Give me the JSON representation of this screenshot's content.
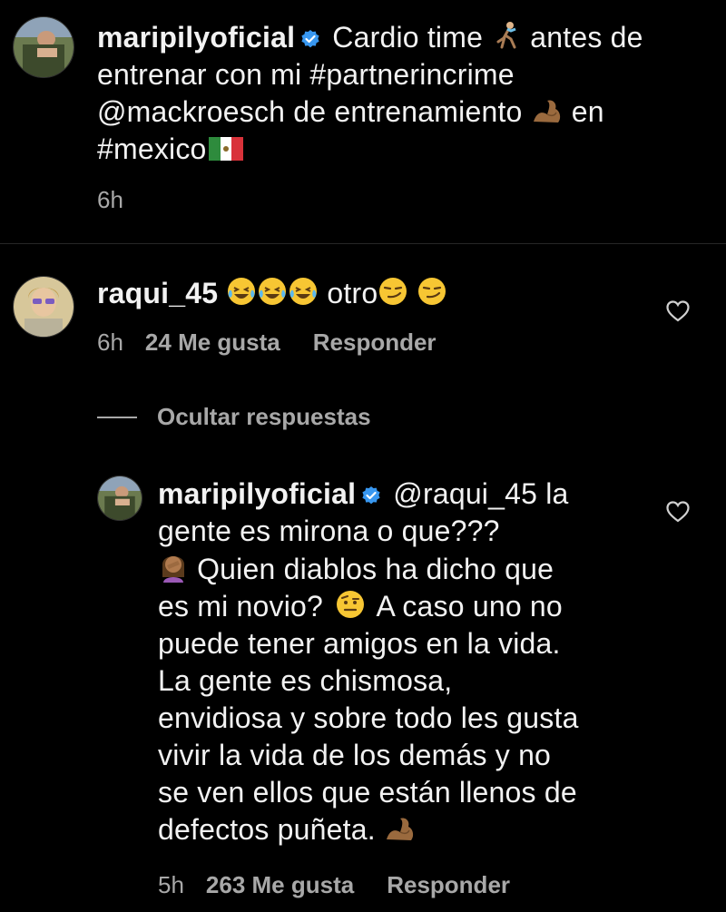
{
  "post": {
    "username": "maripilyoficial",
    "caption_parts": {
      "a": "Cardio time",
      "b": "antes de",
      "c": "entrenar con mi #partnerincrime",
      "d": "@mackroesch de entrenamiento",
      "e": "en",
      "f": "#mexico"
    },
    "time": "6h",
    "icons": [
      "running-woman-emoji",
      "flexed-biceps-emoji",
      "mexico-flag-emoji",
      "verified-badge"
    ]
  },
  "comment": {
    "username": "raqui_45",
    "text": "otro",
    "time": "6h",
    "likes": "24 Me gusta",
    "reply": "Responder",
    "icons": [
      "laughing-tears-emoji",
      "smirk-emoji",
      "heart-icon"
    ]
  },
  "hide_replies": "Ocultar respuestas",
  "reply": {
    "username": "maripilyoficial",
    "lines": {
      "l1": "@raqui_45 la",
      "l2": "gente es mirona o que???",
      "l3": "Quien diablos ha dicho que",
      "l4": "es mi novio?",
      "l4b": "A caso uno no",
      "l5": "puede tener amigos en la vida.",
      "l6": "La gente es chismosa,",
      "l7": "envidiosa y sobre todo les gusta",
      "l8": "vivir la vida de los demás y no",
      "l9": "se ven ellos que están llenos de",
      "l10": "defectos puñeta."
    },
    "time": "5h",
    "likes": "263 Me gusta",
    "reply": "Responder",
    "icons": [
      "facepalm-woman-emoji",
      "raised-eyebrow-emoji",
      "flexed-biceps-emoji",
      "heart-icon"
    ]
  },
  "colors": {
    "background": "#000000",
    "text": "#f2f2f2",
    "meta": "#a8a8a8",
    "verified": "#3897f0"
  }
}
